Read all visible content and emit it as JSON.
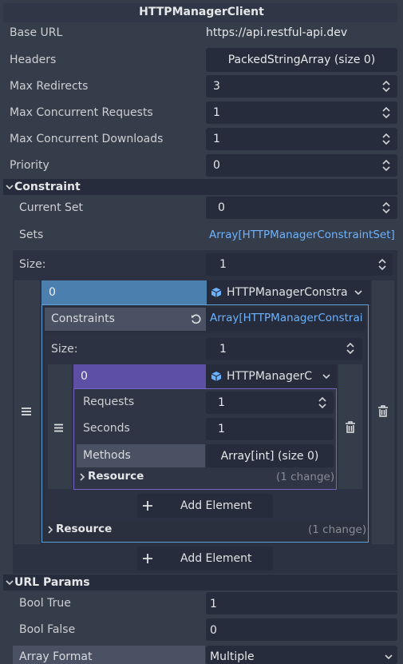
{
  "title": "HTTPManagerClient",
  "props": {
    "base_url": {
      "label": "Base URL",
      "value": "https://api.restful-api.dev"
    },
    "headers": {
      "label": "Headers",
      "value": "PackedStringArray (size 0)"
    },
    "max_redirects": {
      "label": "Max Redirects",
      "value": "3"
    },
    "max_concurrent_requests": {
      "label": "Max Concurrent Requests",
      "value": "1"
    },
    "max_concurrent_downloads": {
      "label": "Max Concurrent Downloads",
      "value": "1"
    },
    "priority": {
      "label": "Priority",
      "value": "0"
    }
  },
  "constraint": {
    "section": "Constraint",
    "current_set": {
      "label": "Current Set",
      "value": "0"
    },
    "sets": {
      "label": "Sets",
      "value": "Array[HTTPManagerConstraintSet]"
    },
    "size": {
      "label": "Size:",
      "value": "1"
    },
    "item0": {
      "index": "0",
      "type": "HTTPManagerConstra",
      "constraints": {
        "label": "Constraints",
        "value": "Array[HTTPManagerConstrai"
      },
      "size": {
        "label": "Size:",
        "value": "1"
      },
      "inner0": {
        "index": "0",
        "type": "HTTPManagerC",
        "requests": {
          "label": "Requests",
          "value": "1"
        },
        "seconds": {
          "label": "Seconds",
          "value": "1"
        },
        "methods": {
          "label": "Methods",
          "value": "Array[int] (size 0)"
        },
        "resource": {
          "label": "Resource",
          "changes": "(1 change)"
        }
      },
      "add_element": "Add Element",
      "resource": {
        "label": "Resource",
        "changes": "(1 change)"
      }
    },
    "add_element": "Add Element"
  },
  "url_params": {
    "section": "URL Params",
    "bool_true": {
      "label": "Bool True",
      "value": "1"
    },
    "bool_false": {
      "label": "Bool False",
      "value": "0"
    },
    "array_format": {
      "label": "Array Format",
      "value": "Multiple"
    }
  }
}
